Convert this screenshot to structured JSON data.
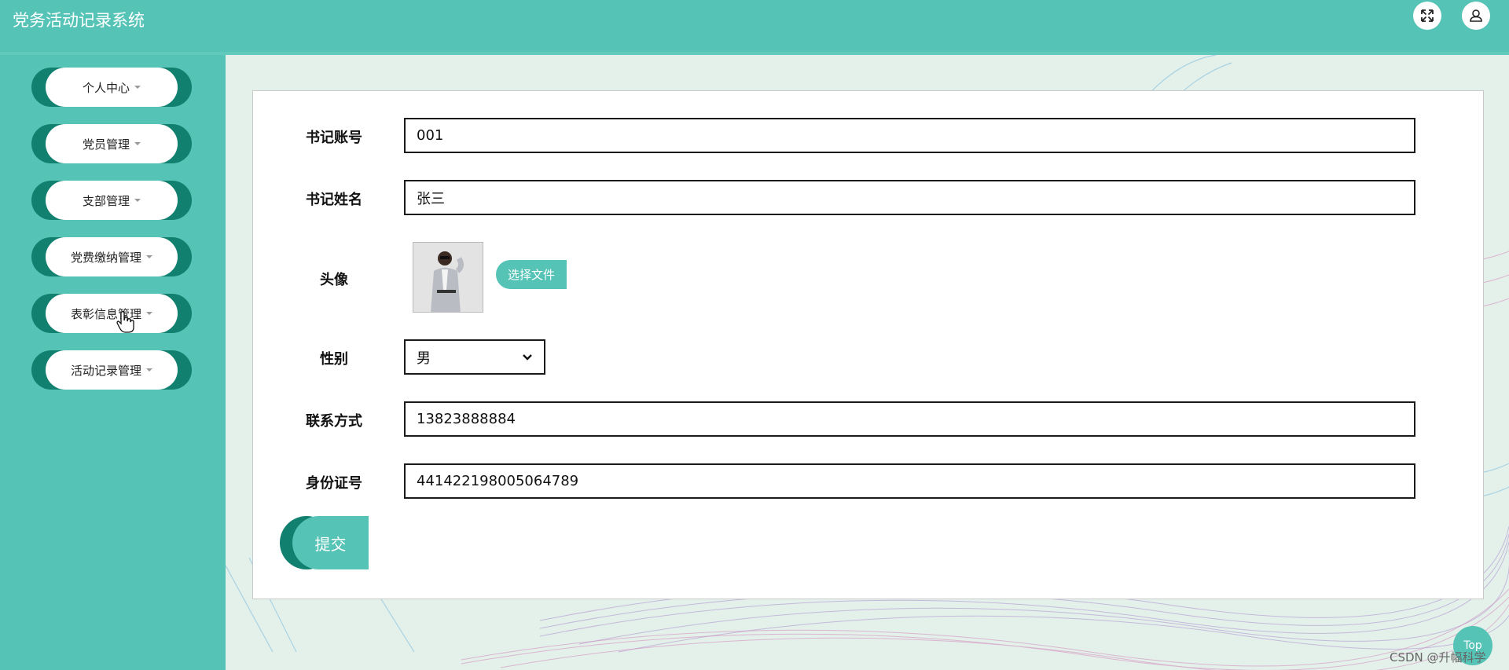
{
  "app": {
    "title": "党务活动记录系统"
  },
  "header": {
    "fullscreen_icon": "fullscreen-icon",
    "user_icon": "user-icon"
  },
  "sidebar": {
    "items": [
      {
        "label": "个人中心"
      },
      {
        "label": "党员管理"
      },
      {
        "label": "支部管理"
      },
      {
        "label": "党费缴纳管理"
      },
      {
        "label": "表彰信息管理"
      },
      {
        "label": "活动记录管理"
      }
    ]
  },
  "form": {
    "account": {
      "label": "书记账号",
      "value": "001"
    },
    "name": {
      "label": "书记姓名",
      "value": "张三"
    },
    "avatar": {
      "label": "头像",
      "button": "选择文件"
    },
    "gender": {
      "label": "性别",
      "value": "男"
    },
    "phone": {
      "label": "联系方式",
      "value": "13823888884"
    },
    "id_card": {
      "label": "身份证号",
      "value": "441422198005064789"
    },
    "submit": "提交"
  },
  "top_button": "Top",
  "watermark": "CSDN @升幅科学",
  "colors": {
    "primary": "#55c3b6",
    "dark": "#11806f",
    "background": "#e4f0ea"
  }
}
